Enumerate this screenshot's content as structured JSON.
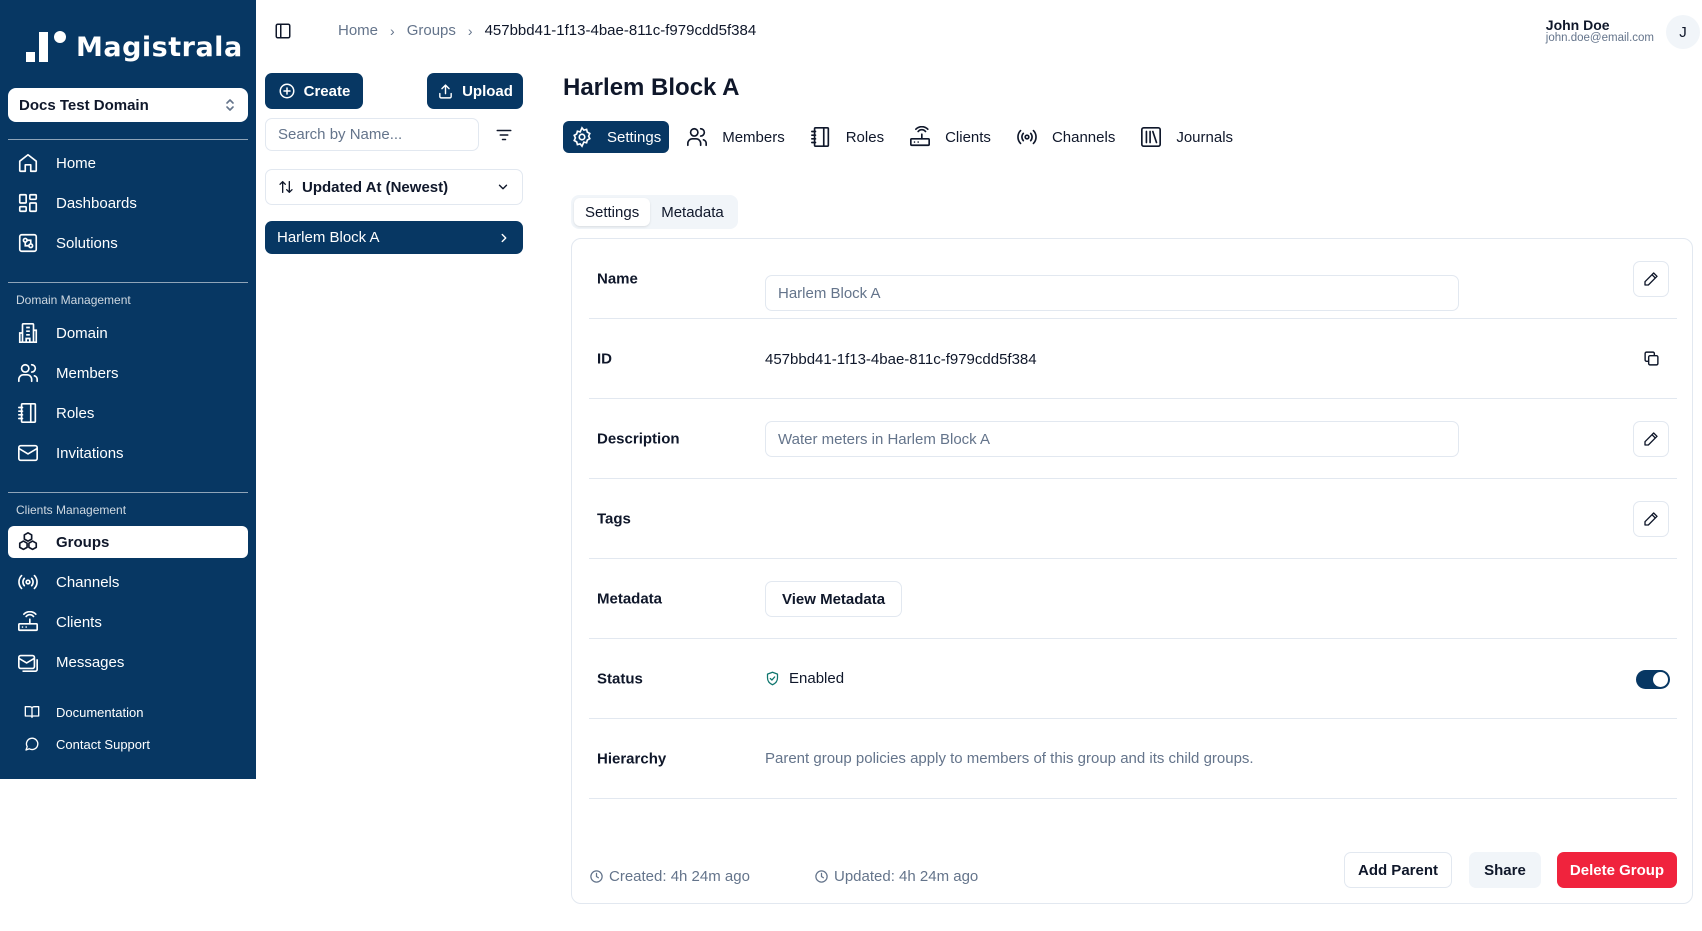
{
  "app": {
    "brand": "Magistrala",
    "domain_name": "Docs Test Domain"
  },
  "sidebar": {
    "main_items": [
      {
        "label": "Home",
        "icon": "home-icon"
      },
      {
        "label": "Dashboards",
        "icon": "dashboard-icon"
      },
      {
        "label": "Solutions",
        "icon": "solutions-icon"
      }
    ],
    "domain_section": "Domain Management",
    "domain_items": [
      {
        "label": "Domain",
        "icon": "domain-icon"
      },
      {
        "label": "Members",
        "icon": "users-icon"
      },
      {
        "label": "Roles",
        "icon": "notebook-icon"
      },
      {
        "label": "Invitations",
        "icon": "mail-icon"
      }
    ],
    "clients_section": "Clients Management",
    "clients_items": [
      {
        "label": "Groups",
        "icon": "groups-icon",
        "active": true
      },
      {
        "label": "Channels",
        "icon": "radio-icon"
      },
      {
        "label": "Clients",
        "icon": "router-icon"
      },
      {
        "label": "Messages",
        "icon": "messages-icon"
      }
    ],
    "footer_items": [
      {
        "label": "Documentation",
        "icon": "book-icon"
      },
      {
        "label": "Contact Support",
        "icon": "chat-icon"
      }
    ]
  },
  "breadcrumb": [
    "Home",
    "Groups",
    "457bbd41-1f13-4bae-811c-f979cdd5f384"
  ],
  "user": {
    "name": "John Doe",
    "email": "john.doe@email.com",
    "initial": "J"
  },
  "list": {
    "create_label": "Create",
    "upload_label": "Upload",
    "search_placeholder": "Search by Name...",
    "sort_label": "Updated At (Newest)",
    "groups": [
      "Harlem Block A"
    ]
  },
  "detail": {
    "title": "Harlem Block A",
    "tabs": [
      "Settings",
      "Members",
      "Roles",
      "Clients",
      "Channels",
      "Journals"
    ],
    "subtabs": [
      "Settings",
      "Metadata"
    ],
    "labels": {
      "name": "Name",
      "id": "ID",
      "description": "Description",
      "tags": "Tags",
      "metadata": "Metadata",
      "status": "Status",
      "hierarchy": "Hierarchy"
    },
    "name_value": "Harlem Block A",
    "id_value": "457bbd41-1f13-4bae-811c-f979cdd5f384",
    "description_value": "Water meters in Harlem Block A",
    "view_metadata_label": "View Metadata",
    "status_value": "Enabled",
    "status_enabled": true,
    "hierarchy_text": "Parent group policies apply to members of this group and its child groups.",
    "created": "Created: 4h 24m ago",
    "updated": "Updated: 4h 24m ago",
    "add_parent_label": "Add Parent",
    "share_label": "Share",
    "delete_label": "Delete Group"
  },
  "colors": {
    "brand": "#073763",
    "danger": "#f0233d",
    "status_ok": "#0f766e"
  }
}
